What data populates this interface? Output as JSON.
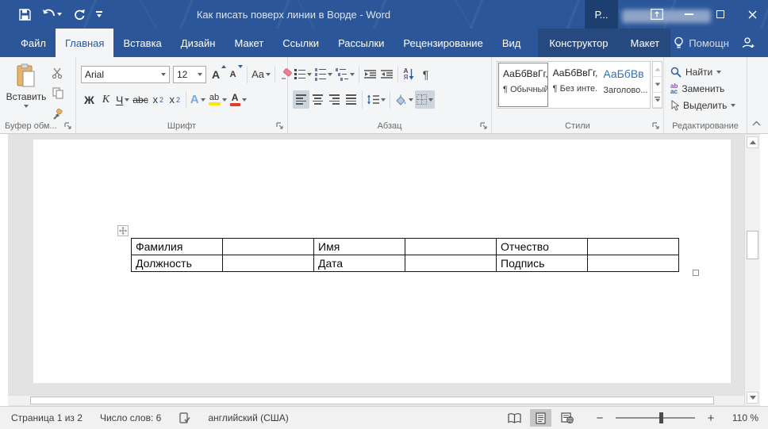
{
  "title_bar": {
    "title": "Как писать поверх линии в Ворде - Word",
    "contextual_label": "Р..."
  },
  "tabs": {
    "file": "Файл",
    "main": [
      "Главная",
      "Вставка",
      "Дизайн",
      "Макет",
      "Ссылки",
      "Рассылки",
      "Рецензирование",
      "Вид"
    ],
    "contextual": [
      "Конструктор",
      "Макет"
    ],
    "assistant": "Помощн"
  },
  "ribbon": {
    "clipboard": {
      "paste_label": "Вставить",
      "group_label": "Буфер обм..."
    },
    "font": {
      "family": "Arial",
      "size": "12",
      "grow": "А",
      "shrink": "А",
      "case_label": "Aa",
      "bold": "Ж",
      "italic": "К",
      "underline": "Ч",
      "strikethrough": "abc",
      "sub_base": "x",
      "sub_mark": "2",
      "sup_base": "x",
      "sup_mark": "2",
      "effects": "А",
      "highlight": "ab",
      "font_color": "А",
      "group_label": "Шрифт"
    },
    "paragraph": {
      "sort_top": "А",
      "sort_bottom": "Я",
      "pilcrow": "¶",
      "group_label": "Абзац"
    },
    "styles": {
      "cards": [
        {
          "preview": "АаБбВвГг,",
          "name": "¶ Обычный"
        },
        {
          "preview": "АаБбВвГг,",
          "name": "¶ Без инте..."
        },
        {
          "preview": "АаБбВв",
          "name": "Заголово..."
        }
      ],
      "group_label": "Стили"
    },
    "editing": {
      "find": "Найти",
      "replace": "Заменить",
      "select": "Выделить",
      "group_label": "Редактирование"
    }
  },
  "document": {
    "table": {
      "rows": [
        [
          "Фамилия",
          "",
          "Имя",
          "",
          "Отчество",
          ""
        ],
        [
          "Должность",
          "",
          "Дата",
          "",
          "Подпись",
          ""
        ]
      ]
    }
  },
  "status_bar": {
    "page_info": "Страница 1 из 2",
    "word_count": "Число слов: 6",
    "language": "английский (США)",
    "zoom_out": "−",
    "zoom_in": "+",
    "zoom_level": "110 %"
  },
  "colors": {
    "accent": "#2b579a",
    "contextual_tab_bg": "#264a7f",
    "heading_style_blue": "#2e74b5",
    "highlight_yellow": "#ffe600",
    "font_color_red": "#e03c31"
  }
}
